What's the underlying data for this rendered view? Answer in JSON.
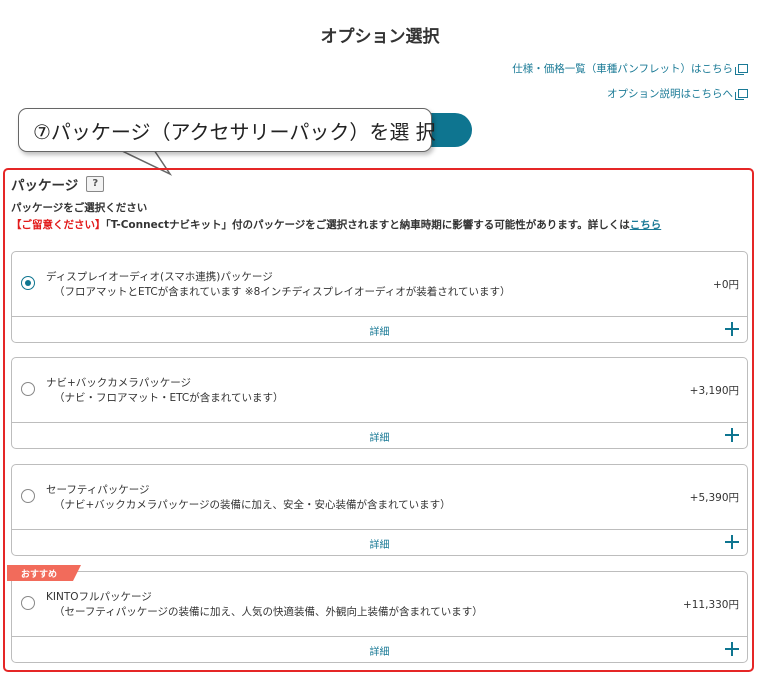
{
  "page": {
    "title": "オプション選択"
  },
  "links": {
    "spec": "仕様・価格一覧（車種パンフレット）はこちら",
    "option_info": "オプション説明はこちらへ"
  },
  "callout": {
    "text": "⑦パッケージ（アクセサリーパック）を選 択"
  },
  "section": {
    "title": "パッケージ",
    "help_icon": "question-icon",
    "prompt": "パッケージをご選択ください",
    "notice_label": "【ご留意ください】",
    "notice_text": "「T-Connectナビキット」付のパッケージをご選択されますと納車時期に影響する可能性があります。詳しくは",
    "notice_link": "こちら"
  },
  "packages": [
    {
      "name": "ディスプレイオーディオ(スマホ連携)パッケージ",
      "desc": "（フロアマットとETCが含まれています ※8インチディスプレイオーディオが装着されています）",
      "price": "+0円",
      "detail": "詳細",
      "selected": true
    },
    {
      "name": "ナビ+バックカメラパッケージ",
      "desc": "（ナビ・フロアマット・ETCが含まれています）",
      "price": "+3,190円",
      "detail": "詳細",
      "selected": false
    },
    {
      "name": "セーフティパッケージ",
      "desc": "（ナビ+バックカメラパッケージの装備に加え、安全・安心装備が含まれています）",
      "price": "+5,390円",
      "detail": "詳細",
      "selected": false
    },
    {
      "name": "KINTOフルパッケージ",
      "desc": "（セーフティパッケージの装備に加え、人気の快適装備、外観向上装備が含まれています）",
      "price": "+11,330円",
      "detail": "詳細",
      "selected": false,
      "badge": "おすすめ"
    }
  ],
  "colors": {
    "accent": "#0e7590",
    "link": "#1a7a96",
    "alert": "#e21b1b",
    "badge": "#f26b5b"
  }
}
